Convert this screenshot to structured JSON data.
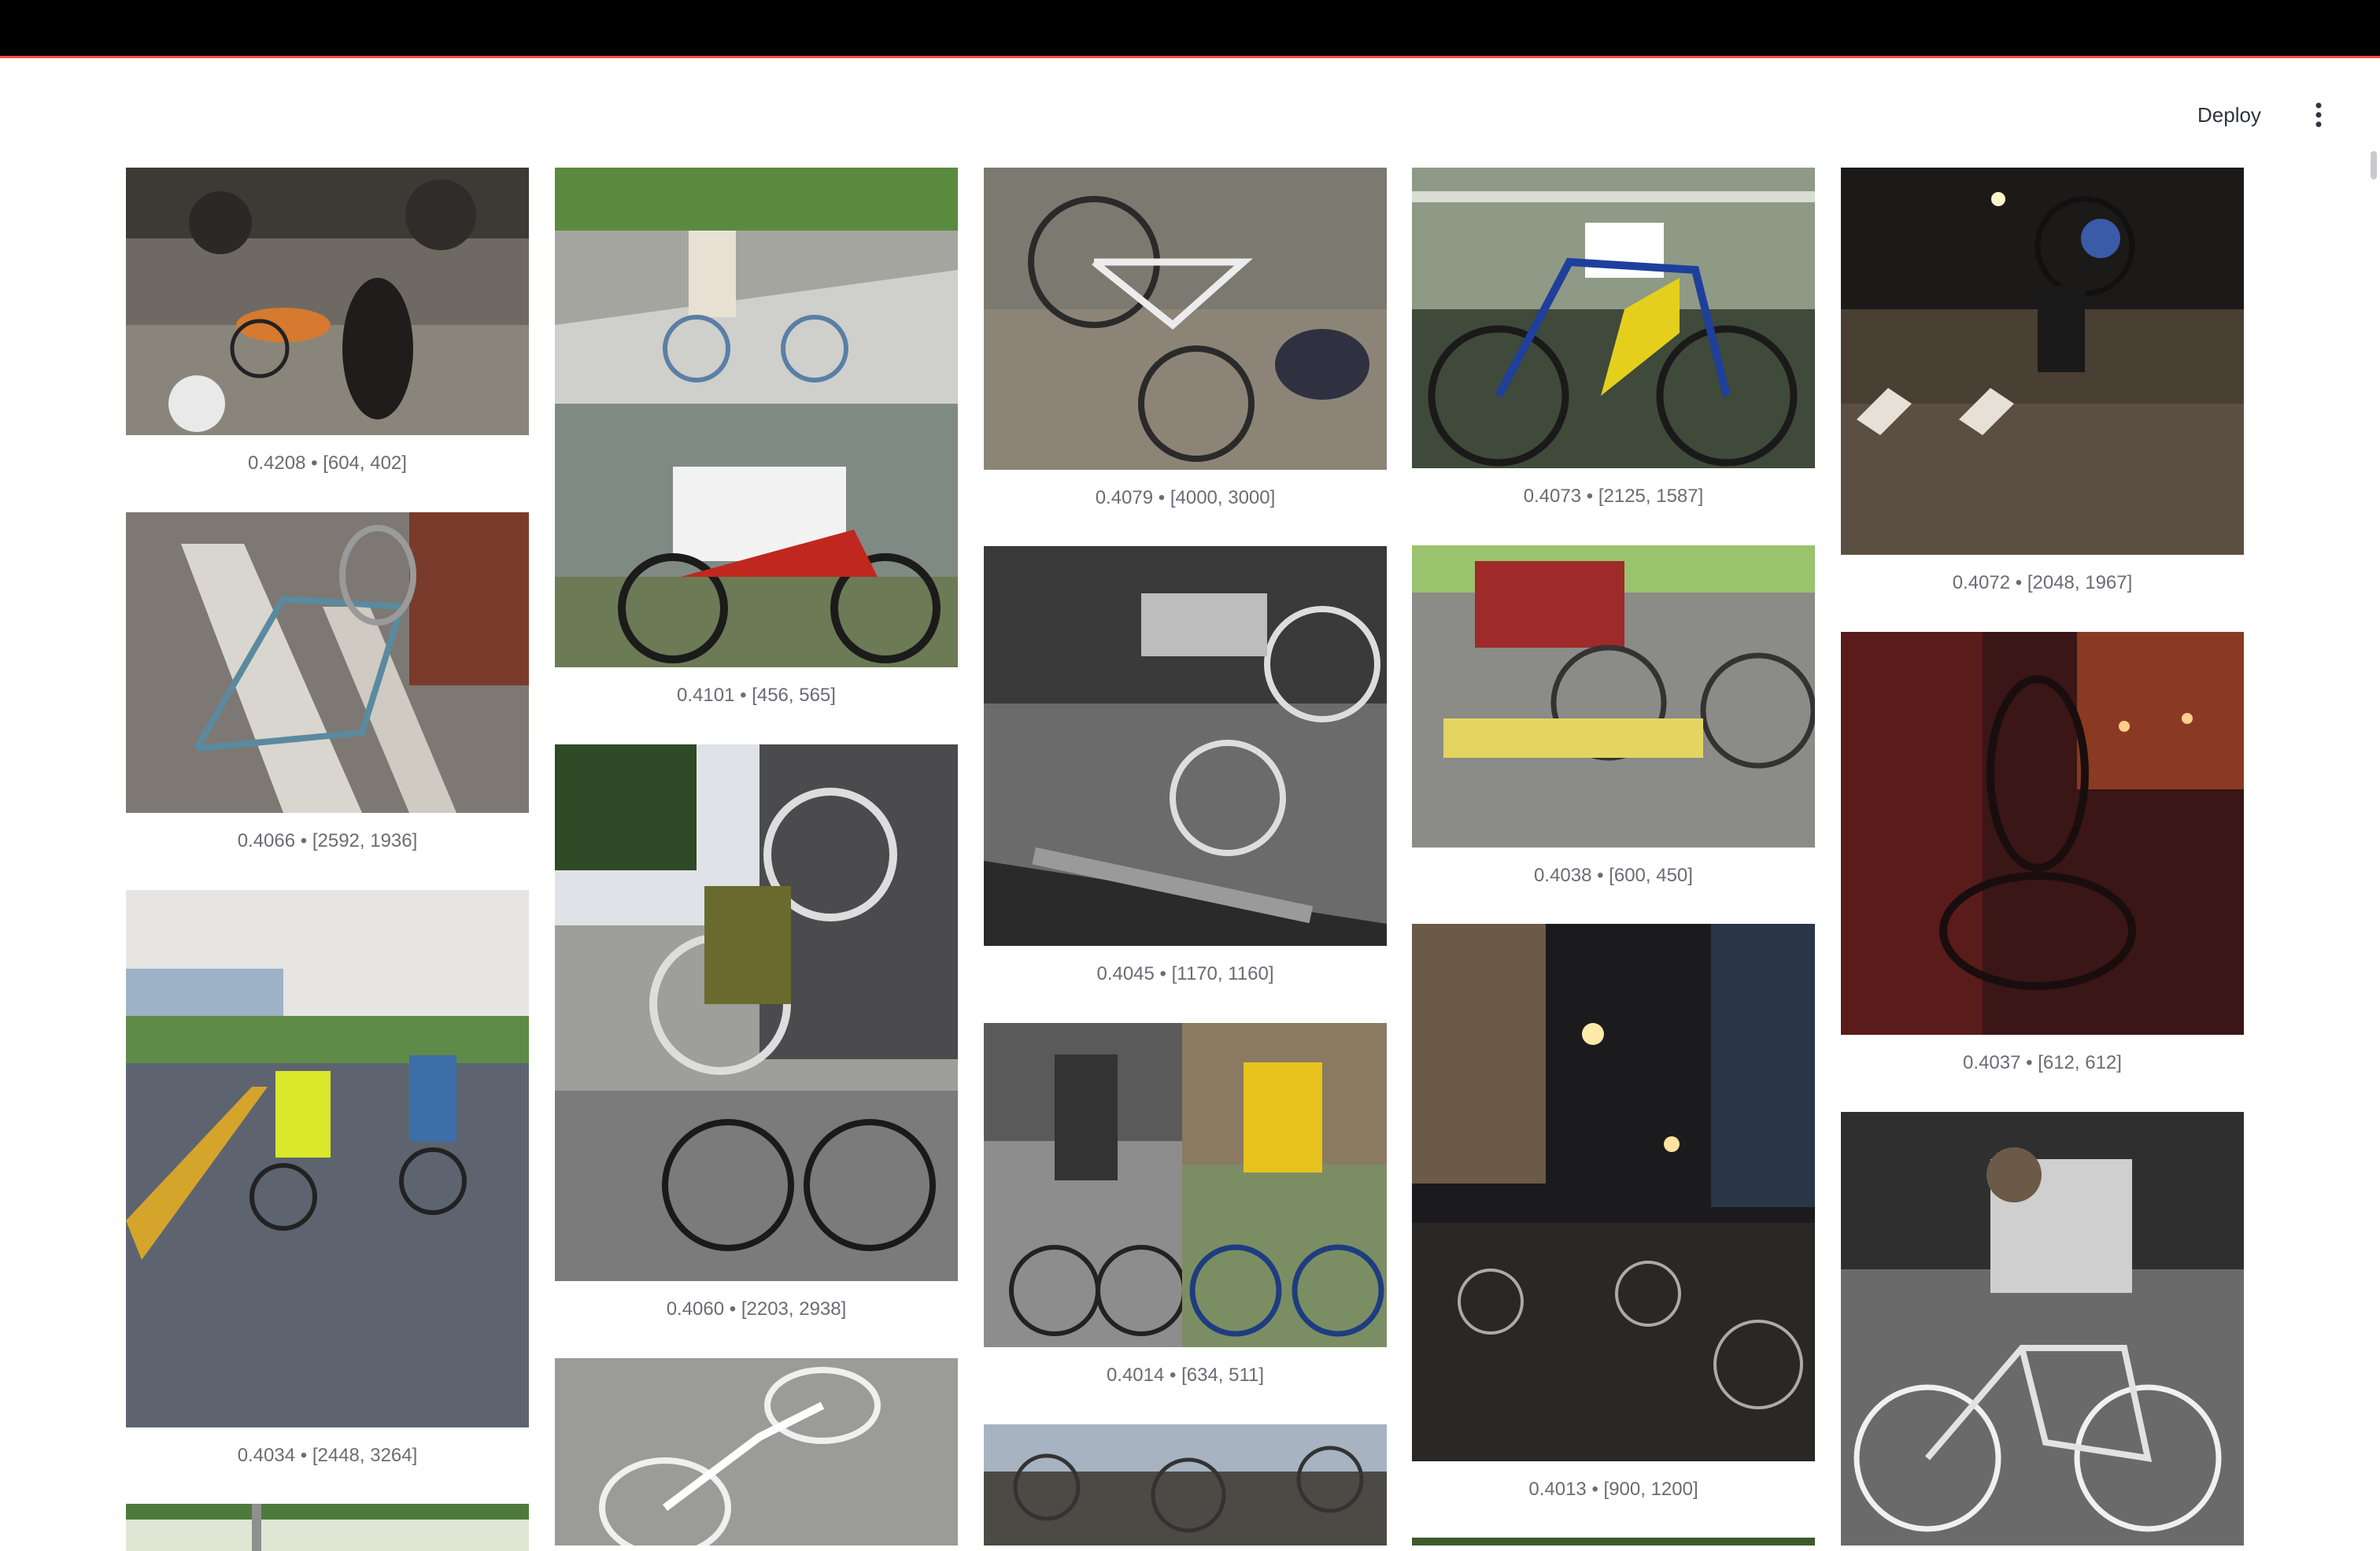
{
  "header": {
    "deploy_label": "Deploy",
    "menu_icon": "kebab-vertical-icon"
  },
  "colors": {
    "accent": "#ff4b4b",
    "caption_text": "#6b6b75",
    "topbar": "#000000"
  },
  "gallery": {
    "captions": [
      "0.4208 • [604, 402]",
      "0.4066 • [2592, 1936]",
      "0.4034 • [2448, 3264]",
      "0.4101 • [456, 565]",
      "0.4060 • [2203, 2938]",
      "0.4079 • [4000, 3000]",
      "0.4045 • [1170, 1160]",
      "0.4014 • [634, 511]",
      "0.4073 • [2125, 1587]",
      "0.4038 • [600, 450]",
      "0.4013 • [900, 1200]",
      "0.4072 • [2048, 1967]",
      "0.4037 • [612, 612]"
    ]
  }
}
